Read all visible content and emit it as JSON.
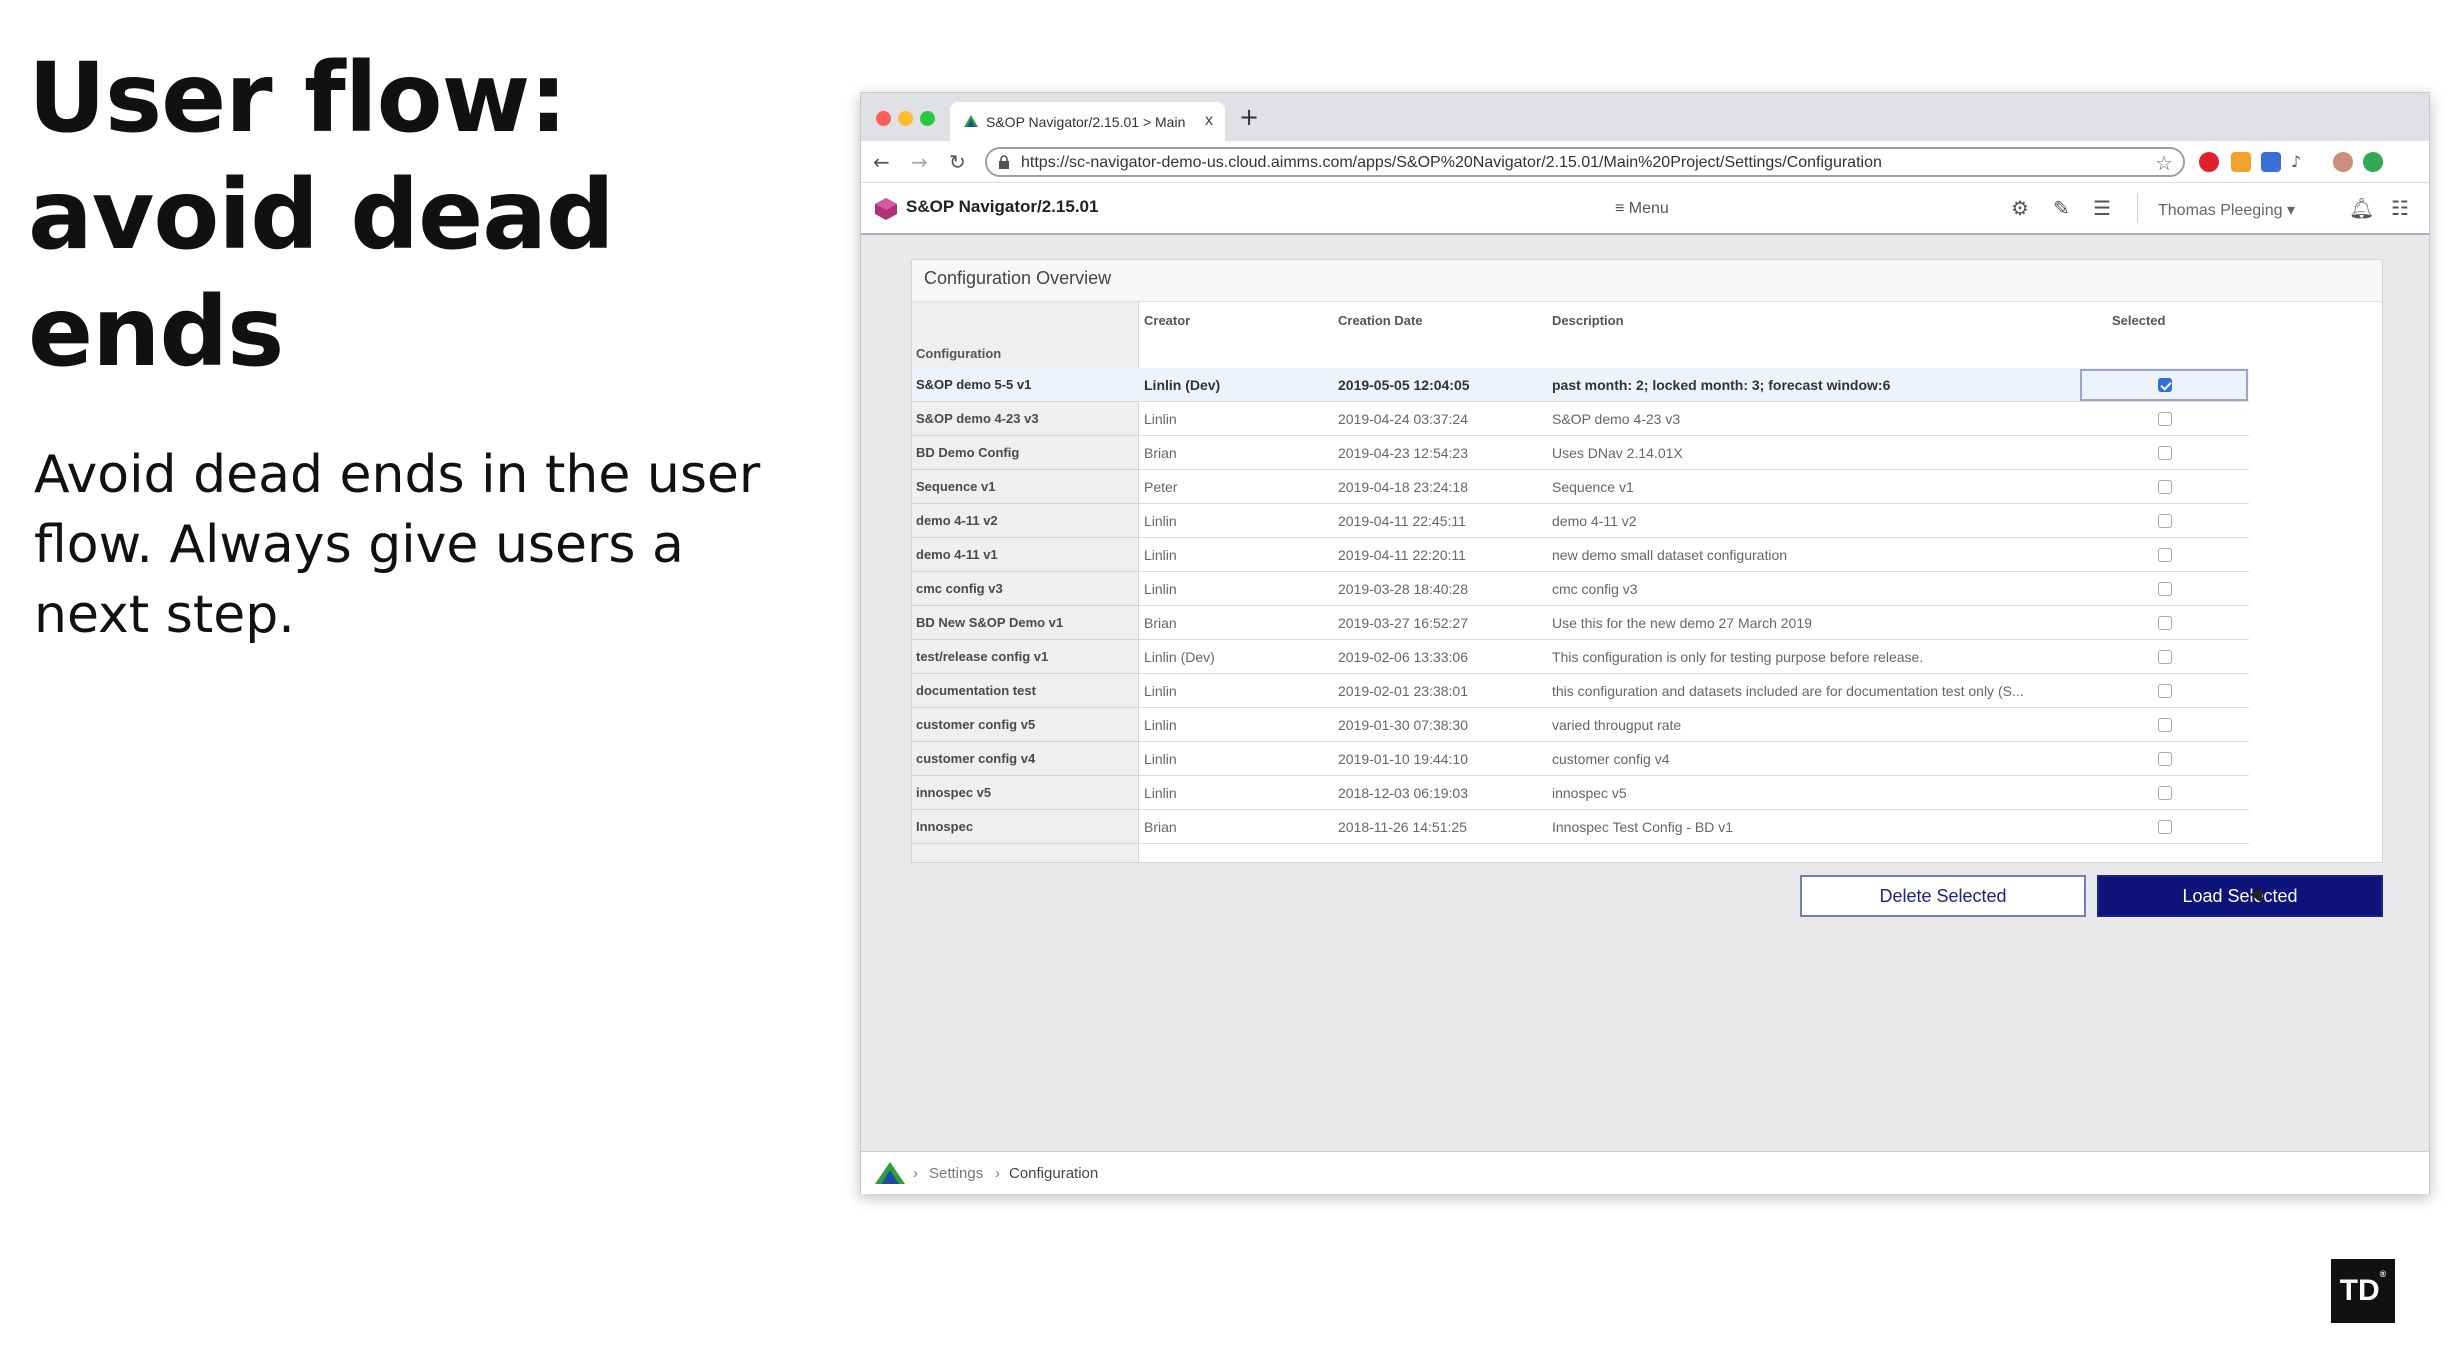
{
  "slide": {
    "title_lines": [
      "User flow:",
      "avoid dead",
      "ends"
    ],
    "subtitle": "Avoid dead ends in the user flow. Always give users a next step.",
    "logo_text": "TD",
    "logo_mark": "®"
  },
  "browser": {
    "tab_title": "S&OP Navigator/2.15.01 > Main",
    "tab_close": "x",
    "new_tab": "+",
    "url": "https://sc-navigator-demo-us.cloud.aimms.com/apps/S&OP%20Navigator/2.15.01/Main%20Project/Settings/Configuration",
    "icons": [
      "back-icon",
      "forward-icon",
      "reload-icon",
      "lock-icon",
      "star-icon"
    ]
  },
  "app": {
    "name": "S&OP Navigator/2.15.01",
    "menu_label": "Menu",
    "user": "Thomas Pleeging",
    "accent_color": "#0d137a"
  },
  "panel": {
    "title": "Configuration Overview",
    "columns": {
      "configuration": "Configuration",
      "creator": "Creator",
      "date": "Creation Date",
      "description": "Description",
      "selected": "Selected"
    },
    "rows": [
      {
        "cfg": "S&OP demo 5-5 v1",
        "creator": "Linlin (Dev)",
        "date": "2019-05-05 12:04:05",
        "desc": "past month: 2; locked month: 3; forecast window:6",
        "selected": true
      },
      {
        "cfg": "S&OP demo 4-23 v3",
        "creator": "Linlin",
        "date": "2019-04-24 03:37:24",
        "desc": "S&OP demo 4-23 v3",
        "selected": false
      },
      {
        "cfg": "BD Demo Config",
        "creator": "Brian",
        "date": "2019-04-23 12:54:23",
        "desc": "Uses DNav 2.14.01X",
        "selected": false
      },
      {
        "cfg": "Sequence v1",
        "creator": "Peter",
        "date": "2019-04-18 23:24:18",
        "desc": "Sequence v1",
        "selected": false
      },
      {
        "cfg": "demo 4-11 v2",
        "creator": "Linlin",
        "date": "2019-04-11 22:45:11",
        "desc": "demo 4-11 v2",
        "selected": false
      },
      {
        "cfg": "demo 4-11 v1",
        "creator": "Linlin",
        "date": "2019-04-11 22:20:11",
        "desc": "new demo small dataset configuration",
        "selected": false
      },
      {
        "cfg": "cmc config v3",
        "creator": "Linlin",
        "date": "2019-03-28 18:40:28",
        "desc": "cmc config v3",
        "selected": false
      },
      {
        "cfg": "BD New S&OP Demo v1",
        "creator": "Brian",
        "date": "2019-03-27 16:52:27",
        "desc": "Use this for the new demo 27 March 2019",
        "selected": false
      },
      {
        "cfg": "test/release config v1",
        "creator": "Linlin (Dev)",
        "date": "2019-02-06 13:33:06",
        "desc": "This configuration is only for testing purpose before release.",
        "selected": false
      },
      {
        "cfg": "documentation test",
        "creator": "Linlin",
        "date": "2019-02-01 23:38:01",
        "desc": "this configuration and datasets included are for documentation test only (S...",
        "selected": false
      },
      {
        "cfg": "customer config v5",
        "creator": "Linlin",
        "date": "2019-01-30 07:38:30",
        "desc": "varied througput rate",
        "selected": false
      },
      {
        "cfg": "customer config v4",
        "creator": "Linlin",
        "date": "2019-01-10 19:44:10",
        "desc": "customer config v4",
        "selected": false
      },
      {
        "cfg": "innospec v5",
        "creator": "Linlin",
        "date": "2018-12-03 06:19:03",
        "desc": "innospec v5",
        "selected": false
      },
      {
        "cfg": "Innospec",
        "creator": "Brian",
        "date": "2018-11-26 14:51:25",
        "desc": "Innospec Test Config - BD v1",
        "selected": false
      }
    ]
  },
  "buttons": {
    "delete": "Delete Selected",
    "load": "Load Selected"
  },
  "footer": {
    "crumbs": [
      "Settings",
      "Configuration"
    ],
    "separator": "›"
  }
}
